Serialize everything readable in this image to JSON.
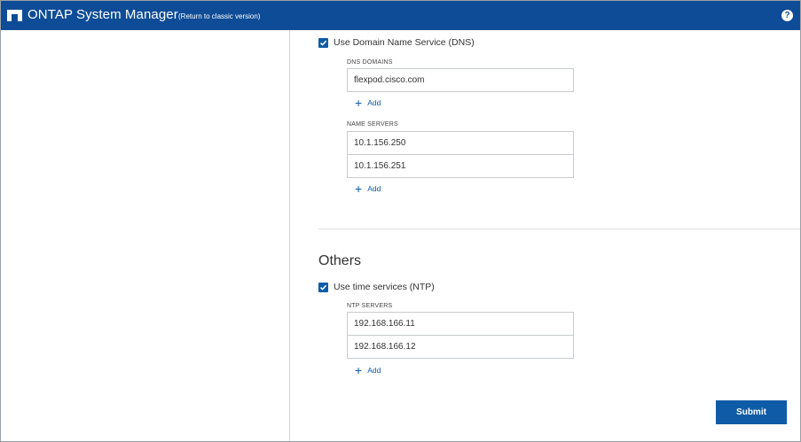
{
  "header": {
    "title": "ONTAP System Manager",
    "classic_link": "(Return to classic version)",
    "help_icon": "?"
  },
  "dns": {
    "checkbox_label": "Use Domain Name Service (DNS)",
    "checked": true,
    "domains_label": "DNS DOMAINS",
    "domains": [
      "flexpod.cisco.com"
    ],
    "name_servers_label": "NAME SERVERS",
    "name_servers": [
      "10.1.156.250",
      "10.1.156.251"
    ],
    "add_label": "Add"
  },
  "others": {
    "title": "Others",
    "checkbox_label": "Use time services (NTP)",
    "checked": true,
    "ntp_label": "NTP SERVERS",
    "ntp_servers": [
      "192.168.166.11",
      "192.168.166.12"
    ],
    "add_label": "Add"
  },
  "actions": {
    "submit_label": "Submit"
  },
  "colors": {
    "header_bg": "#0f4c97",
    "accent": "#0f5ba8"
  },
  "icons": {
    "logo": "netapp-logo-icon",
    "help": "help-icon",
    "check": "checkmark-icon",
    "add": "plus-icon"
  }
}
